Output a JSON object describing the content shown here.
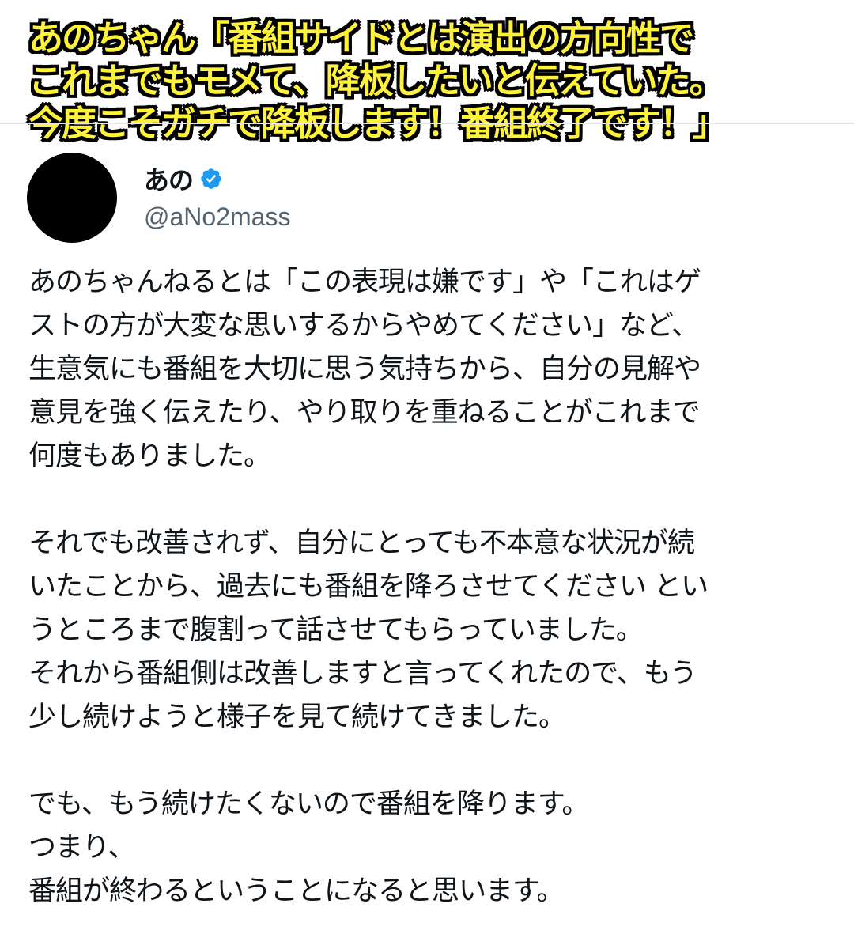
{
  "headline": {
    "lines": [
      "あのちゃん「番組サイドとは演出の方向性で",
      "これまでもモメて、降板したいと伝えていた。",
      "今度こそガチで降板します！番組終了です！」"
    ],
    "text_color": "#fff23a",
    "outline_color": "#000000"
  },
  "tweet": {
    "author": {
      "display_name": "あの",
      "handle": "@aNo2mass",
      "verified": true,
      "verified_icon": "verified-badge-icon",
      "verified_color": "#1d9bf0"
    },
    "paragraphs": [
      {
        "lines": [
          "あのちゃんねるとは「この表現は嫌です」や「これはゲ",
          "ストの方が大変な思いするからやめてください」など、",
          "生意気にも番組を大切に思う気持ちから、自分の見解や",
          "意見を強く伝えたり、やり取りを重ねることがこれまで",
          "何度もありました。"
        ]
      },
      {
        "lines": [
          "それでも改善されず、自分にとっても不本意な状況が続",
          "いたことから、過去にも番組を降ろさせてください とい",
          "うところまで腹割って話させてもらっていました。",
          "それから番組側は改善しますと言ってくれたので、もう",
          "少し続けようと様子を見て続けてきました。"
        ]
      },
      {
        "lines": [
          "でも、もう続けたくないので番組を降ります。",
          "つまり、",
          "番組が終わるということになると思います。"
        ]
      }
    ]
  }
}
